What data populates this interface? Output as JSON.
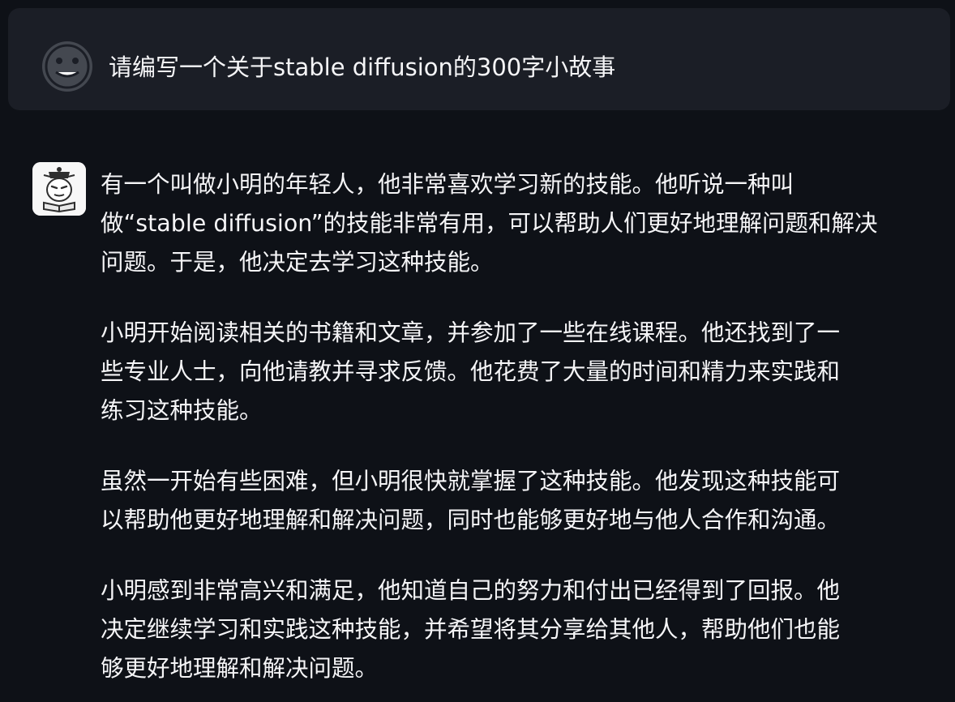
{
  "user_message": {
    "avatar_icon": "neutral-face-icon",
    "text": "请编写一个关于stable diffusion的300字小故事"
  },
  "assistant_message": {
    "avatar_icon": "robot-scholar-icon",
    "paragraphs": [
      [
        "有一个叫做小明的年轻人，他非常喜欢学习新的技能。他听说一种叫",
        "做“stable diffusion”的技能非常有用，可以帮助人们更好地理解问题和解决",
        "问题。于是，他决定去学习这种技能。"
      ],
      [
        "小明开始阅读相关的书籍和文章，并参加了一些在线课程。他还找到了一",
        "些专业人士，向他请教并寻求反馈。他花费了大量的时间和精力来实践和",
        "练习这种技能。"
      ],
      [
        "虽然一开始有些困难，但小明很快就掌握了这种技能。他发现这种技能可",
        "以帮助他更好地理解和解决问题，同时也能够更好地与他人合作和沟通。"
      ],
      [
        "小明感到非常高兴和满足，他知道自己的努力和付出已经得到了回报。他",
        "决定继续学习和实践这种技能，并希望将其分享给其他人，帮助他们也能",
        "够更好地理解和解决问题。"
      ]
    ]
  },
  "colors": {
    "background": "#0e1117",
    "user_bubble": "#1b1e26",
    "text": "#f5f5f7"
  }
}
